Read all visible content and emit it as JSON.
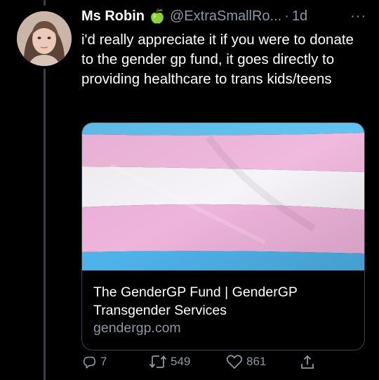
{
  "author": {
    "name": "Ms Robin",
    "badge_icon": "green-apple-emoji",
    "handle": "@ExtraSmallRo...",
    "separator": "·",
    "time": "1d",
    "more_label": "···"
  },
  "tweet": {
    "text": "i'd really appreciate it if you were to donate to the gender gp fund, it goes directly to providing healthcare to trans kids/teens"
  },
  "card": {
    "image_icon": "transgender-pride-flag-image",
    "title": "The GenderGP Fund | GenderGP Transgender Services",
    "domain": "gendergp.com"
  },
  "actions": {
    "reply_count": "7",
    "retweet_count": "549",
    "like_count": "861"
  },
  "colors": {
    "background": "#000000",
    "text": "#ffffff",
    "secondary": "#8b98a5",
    "flag_blue": "#5bcefa",
    "flag_pink": "#f5a9b8",
    "flag_white": "#ffffff"
  }
}
